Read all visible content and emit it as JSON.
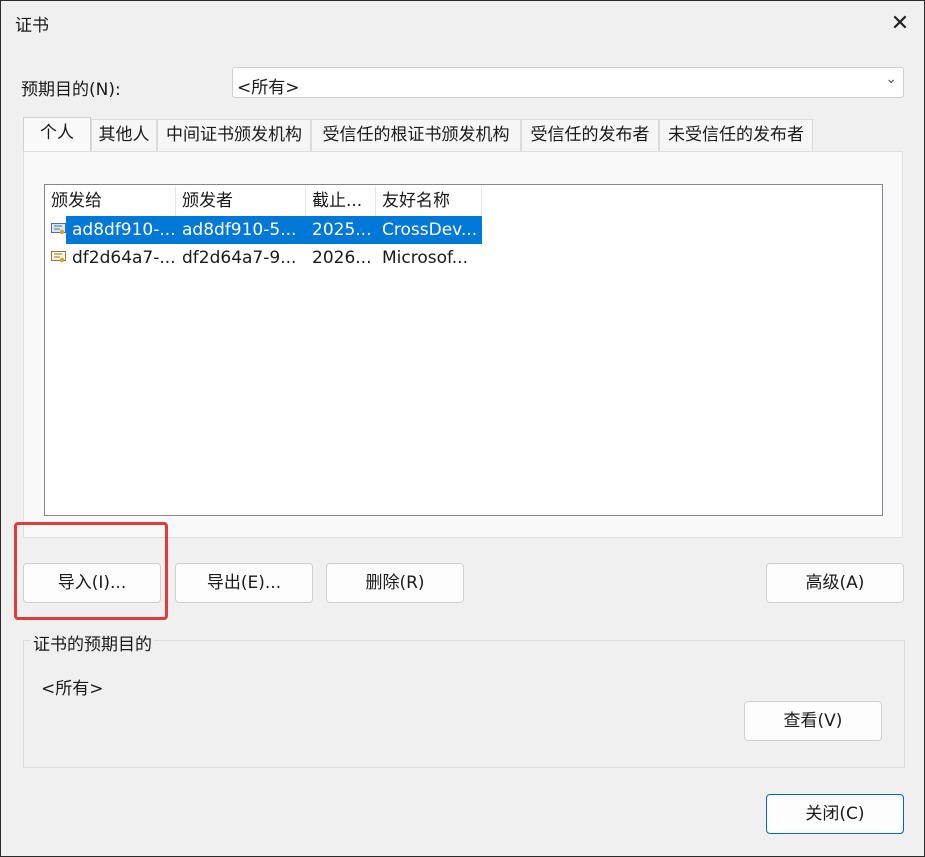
{
  "window": {
    "title": "证书",
    "close_glyph": "✕"
  },
  "purpose": {
    "label": "预期目的(N):",
    "value": "<所有>",
    "chevron": "⌄"
  },
  "tabs": [
    {
      "label": "个人",
      "active": true
    },
    {
      "label": "其他人"
    },
    {
      "label": "中间证书颁发机构"
    },
    {
      "label": "受信任的根证书颁发机构"
    },
    {
      "label": "受信任的发布者"
    },
    {
      "label": "未受信任的发布者"
    }
  ],
  "list": {
    "columns": [
      "颁发给",
      "颁发者",
      "截止...",
      "友好名称"
    ],
    "rows": [
      {
        "issued_to": "ad8df910-...",
        "issuer": "ad8df910-5...",
        "expiry": "2025...",
        "friendly": "CrossDev...",
        "selected": true,
        "icon": "certificate-icon"
      },
      {
        "issued_to": "df2d64a7-...",
        "issuer": "df2d64a7-9...",
        "expiry": "2026...",
        "friendly": "Microsof...",
        "selected": false,
        "icon": "certificate-icon"
      }
    ]
  },
  "buttons": {
    "import": "导入(I)...",
    "export": "导出(E)...",
    "remove": "删除(R)",
    "advanced": "高级(A)",
    "view": "查看(V)",
    "close": "关闭(C)"
  },
  "purposes_group": {
    "label": "证书的预期目的",
    "value": "<所有>"
  },
  "colors": {
    "selection": "#0078d7",
    "highlight": "#e03c3c"
  }
}
